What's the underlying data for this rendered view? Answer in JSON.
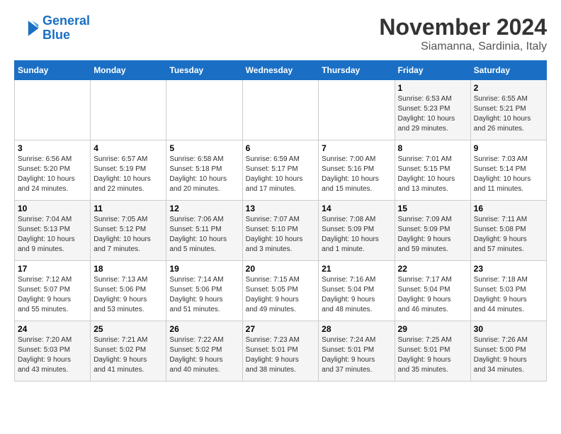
{
  "header": {
    "logo_line1": "General",
    "logo_line2": "Blue",
    "month": "November 2024",
    "location": "Siamanna, Sardinia, Italy"
  },
  "weekdays": [
    "Sunday",
    "Monday",
    "Tuesday",
    "Wednesday",
    "Thursday",
    "Friday",
    "Saturday"
  ],
  "weeks": [
    [
      {
        "day": "",
        "info": ""
      },
      {
        "day": "",
        "info": ""
      },
      {
        "day": "",
        "info": ""
      },
      {
        "day": "",
        "info": ""
      },
      {
        "day": "",
        "info": ""
      },
      {
        "day": "1",
        "info": "Sunrise: 6:53 AM\nSunset: 5:23 PM\nDaylight: 10 hours\nand 29 minutes."
      },
      {
        "day": "2",
        "info": "Sunrise: 6:55 AM\nSunset: 5:21 PM\nDaylight: 10 hours\nand 26 minutes."
      }
    ],
    [
      {
        "day": "3",
        "info": "Sunrise: 6:56 AM\nSunset: 5:20 PM\nDaylight: 10 hours\nand 24 minutes."
      },
      {
        "day": "4",
        "info": "Sunrise: 6:57 AM\nSunset: 5:19 PM\nDaylight: 10 hours\nand 22 minutes."
      },
      {
        "day": "5",
        "info": "Sunrise: 6:58 AM\nSunset: 5:18 PM\nDaylight: 10 hours\nand 20 minutes."
      },
      {
        "day": "6",
        "info": "Sunrise: 6:59 AM\nSunset: 5:17 PM\nDaylight: 10 hours\nand 17 minutes."
      },
      {
        "day": "7",
        "info": "Sunrise: 7:00 AM\nSunset: 5:16 PM\nDaylight: 10 hours\nand 15 minutes."
      },
      {
        "day": "8",
        "info": "Sunrise: 7:01 AM\nSunset: 5:15 PM\nDaylight: 10 hours\nand 13 minutes."
      },
      {
        "day": "9",
        "info": "Sunrise: 7:03 AM\nSunset: 5:14 PM\nDaylight: 10 hours\nand 11 minutes."
      }
    ],
    [
      {
        "day": "10",
        "info": "Sunrise: 7:04 AM\nSunset: 5:13 PM\nDaylight: 10 hours\nand 9 minutes."
      },
      {
        "day": "11",
        "info": "Sunrise: 7:05 AM\nSunset: 5:12 PM\nDaylight: 10 hours\nand 7 minutes."
      },
      {
        "day": "12",
        "info": "Sunrise: 7:06 AM\nSunset: 5:11 PM\nDaylight: 10 hours\nand 5 minutes."
      },
      {
        "day": "13",
        "info": "Sunrise: 7:07 AM\nSunset: 5:10 PM\nDaylight: 10 hours\nand 3 minutes."
      },
      {
        "day": "14",
        "info": "Sunrise: 7:08 AM\nSunset: 5:09 PM\nDaylight: 10 hours\nand 1 minute."
      },
      {
        "day": "15",
        "info": "Sunrise: 7:09 AM\nSunset: 5:09 PM\nDaylight: 9 hours\nand 59 minutes."
      },
      {
        "day": "16",
        "info": "Sunrise: 7:11 AM\nSunset: 5:08 PM\nDaylight: 9 hours\nand 57 minutes."
      }
    ],
    [
      {
        "day": "17",
        "info": "Sunrise: 7:12 AM\nSunset: 5:07 PM\nDaylight: 9 hours\nand 55 minutes."
      },
      {
        "day": "18",
        "info": "Sunrise: 7:13 AM\nSunset: 5:06 PM\nDaylight: 9 hours\nand 53 minutes."
      },
      {
        "day": "19",
        "info": "Sunrise: 7:14 AM\nSunset: 5:06 PM\nDaylight: 9 hours\nand 51 minutes."
      },
      {
        "day": "20",
        "info": "Sunrise: 7:15 AM\nSunset: 5:05 PM\nDaylight: 9 hours\nand 49 minutes."
      },
      {
        "day": "21",
        "info": "Sunrise: 7:16 AM\nSunset: 5:04 PM\nDaylight: 9 hours\nand 48 minutes."
      },
      {
        "day": "22",
        "info": "Sunrise: 7:17 AM\nSunset: 5:04 PM\nDaylight: 9 hours\nand 46 minutes."
      },
      {
        "day": "23",
        "info": "Sunrise: 7:18 AM\nSunset: 5:03 PM\nDaylight: 9 hours\nand 44 minutes."
      }
    ],
    [
      {
        "day": "24",
        "info": "Sunrise: 7:20 AM\nSunset: 5:03 PM\nDaylight: 9 hours\nand 43 minutes."
      },
      {
        "day": "25",
        "info": "Sunrise: 7:21 AM\nSunset: 5:02 PM\nDaylight: 9 hours\nand 41 minutes."
      },
      {
        "day": "26",
        "info": "Sunrise: 7:22 AM\nSunset: 5:02 PM\nDaylight: 9 hours\nand 40 minutes."
      },
      {
        "day": "27",
        "info": "Sunrise: 7:23 AM\nSunset: 5:01 PM\nDaylight: 9 hours\nand 38 minutes."
      },
      {
        "day": "28",
        "info": "Sunrise: 7:24 AM\nSunset: 5:01 PM\nDaylight: 9 hours\nand 37 minutes."
      },
      {
        "day": "29",
        "info": "Sunrise: 7:25 AM\nSunset: 5:01 PM\nDaylight: 9 hours\nand 35 minutes."
      },
      {
        "day": "30",
        "info": "Sunrise: 7:26 AM\nSunset: 5:00 PM\nDaylight: 9 hours\nand 34 minutes."
      }
    ]
  ]
}
